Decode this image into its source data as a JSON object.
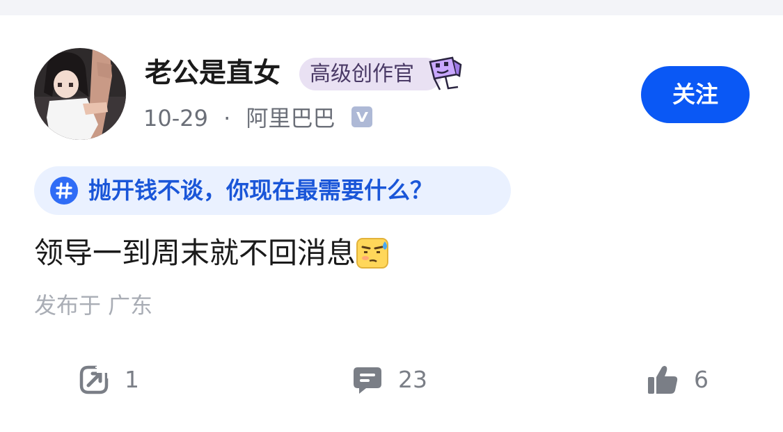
{
  "post": {
    "author": {
      "name": "老公是直女",
      "badge": "高级创作官"
    },
    "date": "10-29",
    "separator": "·",
    "company": "阿里巴巴",
    "follow_label": "关注",
    "topic": "抛开钱不谈，你现在最需要什么？",
    "content": "领导一到周末就不回消息",
    "location": "发布于 广东",
    "actions": {
      "share_count": "1",
      "comment_count": "23",
      "like_count": "6"
    }
  },
  "icons": {
    "verified": "verified-v-icon",
    "topic": "hashtag-icon",
    "share": "share-icon",
    "comment": "comment-icon",
    "like": "thumbs-up-icon",
    "emoji": "sweat-emoji-icon",
    "badge": "creator-badge-icon"
  },
  "colors": {
    "accent": "#0a58f5",
    "topic_text": "#1a56d8",
    "topic_bg": "#eaf1ff",
    "badge_bg": "#e9e1f3",
    "badge_text": "#4a3a66",
    "muted": "#a9adb5"
  }
}
